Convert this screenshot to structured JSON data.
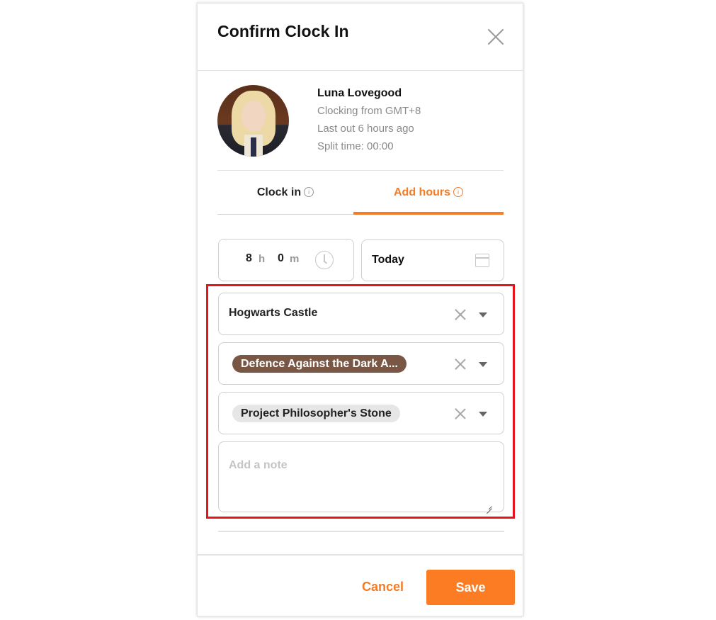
{
  "dialog": {
    "title": "Confirm Clock In",
    "close_icon": "close-icon"
  },
  "user": {
    "name": "Luna Lovegood",
    "timezone_text": "Clocking from GMT+8",
    "last_out_text": "Last out 6 hours ago",
    "split_time_text": "Split time: 00:00"
  },
  "tabs": [
    {
      "label": "Clock in",
      "icon": "info-icon",
      "active": false
    },
    {
      "label": "Add hours",
      "icon": "info-icon",
      "active": true
    }
  ],
  "tab_info_glyph": "i",
  "duration": {
    "hours": "8",
    "hours_unit": "h",
    "minutes": "0",
    "minutes_unit": "m",
    "icon": "clock-icon"
  },
  "date": {
    "value": "Today",
    "icon": "calendar-icon"
  },
  "selects": {
    "location": {
      "value": "Hogwarts Castle"
    },
    "job": {
      "value": "Defence Against the Dark A...",
      "chip_color": "#7a5645"
    },
    "project": {
      "value": "Project Philosopher's Stone",
      "chip_color": "#e6e6e6"
    }
  },
  "note": {
    "placeholder": "Add a note",
    "value": ""
  },
  "footer": {
    "cancel_label": "Cancel",
    "save_label": "Save"
  },
  "colors": {
    "accent": "#f27c27",
    "save_button": "#fb7c22",
    "highlight_border": "#e8141a"
  }
}
